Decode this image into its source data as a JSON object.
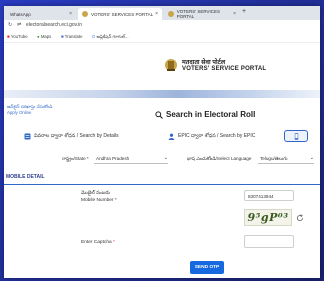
{
  "browser": {
    "tabs": [
      {
        "label": "WhatsApp"
      },
      {
        "label": "VOTERS' SERVICES PORTAL"
      },
      {
        "label": "VOTERS' SERVICES PORTAL"
      }
    ],
    "url": "electoralsearch.eci.gov.in",
    "bookmarks": [
      {
        "label": "YouTube"
      },
      {
        "label": "Maps"
      },
      {
        "label": "Translate"
      },
      {
        "label": "ఆప్లికేషన్ గూగుల్..."
      }
    ]
  },
  "header": {
    "title_hindi": "मतदाता सेवा पोर्टल",
    "title_english": "VOTERS' SERVICE PORTAL"
  },
  "page": {
    "apply_online_te": "ఆన్‌లైన్ దరఖాస్తు చేసుకోండి",
    "apply_online_en": "Apply Online",
    "search_heading": "Search in Electoral Roll",
    "tabs": {
      "details": "వివరాల ద్వారా శోధన / Search by Details",
      "epic": "EPIC ద్వారా శోధన / Search by EPIC"
    },
    "state_label": "రాష్ట్రం/State *",
    "state_value": "Andhra Pradesh",
    "language_label": "భాష ఎంచుకోండి/Select Language",
    "language_value": "Telugu/తెలుగు",
    "section_title": "MOBILE DETAIL",
    "mobile_label_te": "మొబైల్ నంబరు",
    "mobile_label_en": "Mobile Number *",
    "mobile_value": "8307413944",
    "captcha_text": "9⁵gP⁰³",
    "captcha_label": "Enter Captcha",
    "captcha_required": "*",
    "send_button": "SEND OTP"
  },
  "colors": {
    "accent": "#1769e0",
    "section": "#2e3f8f",
    "frame": "#1d2a8f"
  }
}
